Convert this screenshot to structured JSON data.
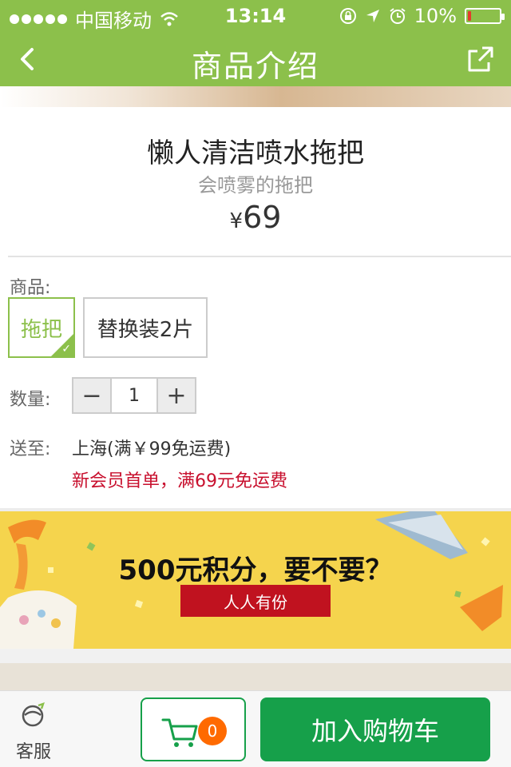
{
  "status_bar": {
    "carrier": "中国移动",
    "time": "13:14",
    "battery": "10%",
    "battery_level": 0.1,
    "battery_color": "#e53a2b"
  },
  "nav": {
    "title": "商品介绍",
    "bar_color": "#8cc04b"
  },
  "product": {
    "title": "懒人清洁喷水拖把",
    "subtitle": "会喷雾的拖把",
    "currency": "¥",
    "price": "69"
  },
  "options": {
    "product_label": "商品:",
    "items": [
      {
        "label": "拖把",
        "selected": true
      },
      {
        "label": "替换装2片",
        "selected": false
      }
    ],
    "quantity_label": "数量:",
    "quantity": "1",
    "shipping_label": "送至:",
    "shipping_destination": "上海(满￥99免运费)",
    "shipping_promo": "新会员首单，满69元免运费"
  },
  "promo_banner": {
    "title": "500元积分，要不要？",
    "tag": "人人有份",
    "background": "#f5d44d",
    "tag_color": "#c0121f"
  },
  "bottom_bar": {
    "service_label": "客服",
    "cart_count": "0",
    "add_to_cart": "加入购物车",
    "accent": "#16a04a",
    "badge_color": "#ff6a00"
  },
  "icons": [
    "back-icon",
    "share-icon",
    "wifi-icon",
    "lock-rotation-icon",
    "location-icon",
    "alarm-icon",
    "battery-icon",
    "check-icon",
    "minus-icon",
    "plus-icon",
    "customer-service-icon",
    "shopping-cart-icon"
  ]
}
